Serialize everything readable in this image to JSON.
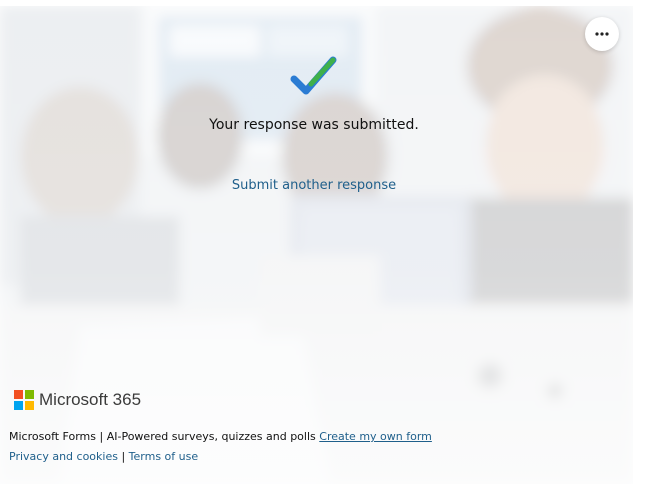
{
  "actions": {
    "more_options_icon": "more-horizontal-icon"
  },
  "confirmation": {
    "icon": "checkmark-icon",
    "message": "Your response was submitted.",
    "submit_another_label": "Submit another response"
  },
  "brand": {
    "logo_icon": "microsoft-logo-icon",
    "name": "Microsoft 365",
    "logo_colors": [
      "#f25022",
      "#7fba00",
      "#00a4ef",
      "#ffb900"
    ]
  },
  "footer": {
    "product": "Microsoft Forms",
    "separator": "|",
    "tagline": "AI-Powered surveys, quizzes and polls",
    "create_link": "Create my own form",
    "privacy_link": "Privacy and cookies",
    "terms_link": "Terms of use"
  },
  "colors": {
    "link": "#1f5f8b",
    "check_blue": "#2b7cd3",
    "check_green": "#3fb04a"
  }
}
